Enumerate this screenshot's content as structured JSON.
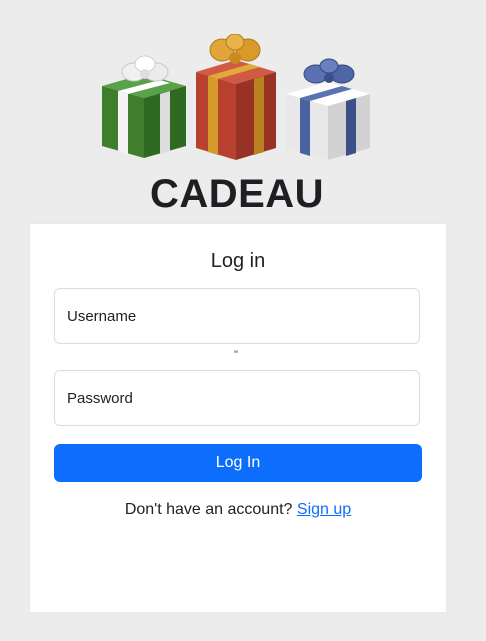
{
  "header": {
    "brand": "CADEAU",
    "logo_colors": {
      "green_box": "#3e7e2c",
      "red_box": "#b8402f",
      "white_box": "#f0f0f0",
      "gold_ribbon": "#d49a2a",
      "blue_ribbon": "#4a62a0",
      "white_ribbon": "#f2f2f2"
    }
  },
  "login": {
    "title": "Log in",
    "username_label": "Username",
    "stray_char": "\"",
    "password_label": "Password",
    "submit_label": "Log In",
    "signup_prompt": "Don't have an account?",
    "signup_link": "Sign up"
  },
  "theme": {
    "background": "#ececec",
    "card": "#ffffff",
    "accent": "#0d6efd"
  }
}
